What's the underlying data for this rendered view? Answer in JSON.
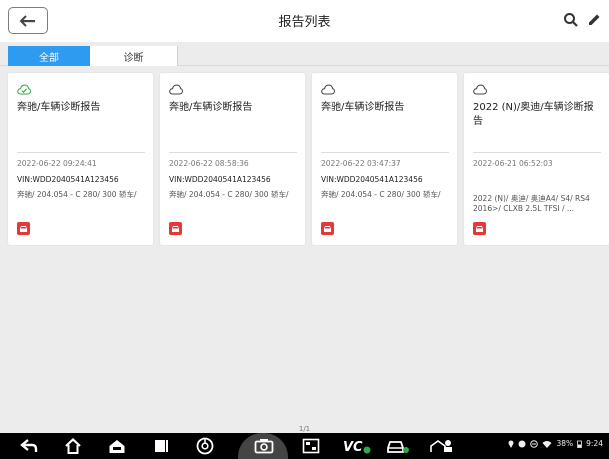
{
  "header": {
    "title": "报告列表"
  },
  "tabs": [
    {
      "label": "全部",
      "active": true
    },
    {
      "label": "诊断",
      "active": false
    }
  ],
  "reports": [
    {
      "title": "奔驰/车辆诊断报告",
      "date": "2022-06-22 09:24:41",
      "vin": "VIN:WDD2040541A123456",
      "vehicle": "奔驰/ 204.054 - C 280/ 300 轿车/",
      "synced": true
    },
    {
      "title": "奔驰/车辆诊断报告",
      "date": "2022-06-22 08:58:36",
      "vin": "VIN:WDD2040541A123456",
      "vehicle": "奔驰/ 204.054 - C 280/ 300 轿车/",
      "synced": false
    },
    {
      "title": "奔驰/车辆诊断报告",
      "date": "2022-06-22 03:47:37",
      "vin": "VIN:WDD2040541A123456",
      "vehicle": "奔驰/ 204.054 - C 280/ 300 轿车/",
      "synced": false
    },
    {
      "title": "2022 (N)/奥迪/车辆诊断报告",
      "date": "2022-06-21 06:52:03",
      "vin": "",
      "vehicle": "2022 (N)/ 奥迪/ 奥迪A4/ S4/ RS4 2016>/ CLXB 2.5L TFSI / ...",
      "synced": false
    }
  ],
  "pagination": {
    "text": "1/1"
  },
  "statusbar": {
    "battery": "38%",
    "time": "9:24"
  },
  "colors": {
    "accent": "#2f9bf0",
    "sync_green": "#2eaa4a",
    "badge_red": "#e23a3a"
  },
  "icons": {
    "back": "back-arrow-icon",
    "search": "search-icon",
    "edit": "pencil-icon",
    "cloud": "cloud-icon",
    "cloud_synced": "cloud-check-icon",
    "car": "car-icon"
  }
}
